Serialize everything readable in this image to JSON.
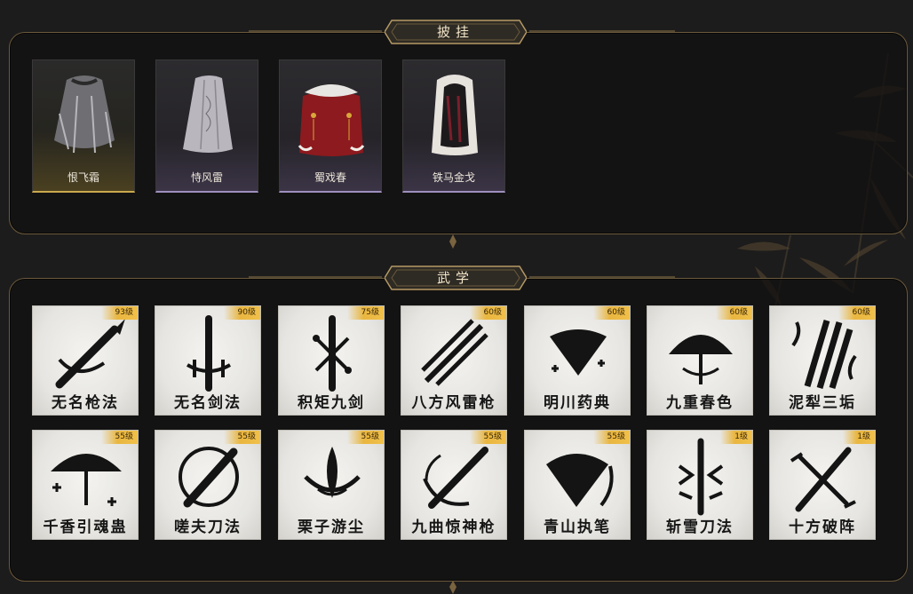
{
  "sections": {
    "cloak_title": "披挂",
    "wuxue_title": "武学"
  },
  "cloaks": [
    {
      "name": "恨飞霜",
      "rarity": "gold"
    },
    {
      "name": "恃风雷",
      "rarity": "purple"
    },
    {
      "name": "蜀戏春",
      "rarity": "purple"
    },
    {
      "name": "铁马金戈",
      "rarity": "purple"
    }
  ],
  "skills": [
    {
      "name": "无名枪法",
      "level": "93级",
      "icon": "spear-icon"
    },
    {
      "name": "无名剑法",
      "level": "90级",
      "icon": "sword-icon"
    },
    {
      "name": "积矩九剑",
      "level": "75级",
      "icon": "sword-icon"
    },
    {
      "name": "八方风雷枪",
      "level": "60级",
      "icon": "spear-icon"
    },
    {
      "name": "明川药典",
      "level": "60级",
      "icon": "fan-icon"
    },
    {
      "name": "九重春色",
      "level": "60级",
      "icon": "umbrella-icon"
    },
    {
      "name": "泥犁三垢",
      "level": "60级",
      "icon": "blades-icon"
    },
    {
      "name": "千香引魂蛊",
      "level": "55级",
      "icon": "umbrella-icon"
    },
    {
      "name": "嗟夫刀法",
      "level": "55级",
      "icon": "blade-icon"
    },
    {
      "name": "栗子游尘",
      "level": "55级",
      "icon": "lotus-icon"
    },
    {
      "name": "九曲惊神枪",
      "level": "55级",
      "icon": "spear-icon"
    },
    {
      "name": "青山执笔",
      "level": "55级",
      "icon": "fan-icon"
    },
    {
      "name": "斩雪刀法",
      "level": "1级",
      "icon": "blade-icon"
    },
    {
      "name": "十方破阵",
      "level": "1级",
      "icon": "crossed-blades-icon"
    }
  ],
  "colors": {
    "frame_gold": "#6b5a3c",
    "badge_gold": "#e9b63f",
    "bg": "#1d1c1c"
  }
}
